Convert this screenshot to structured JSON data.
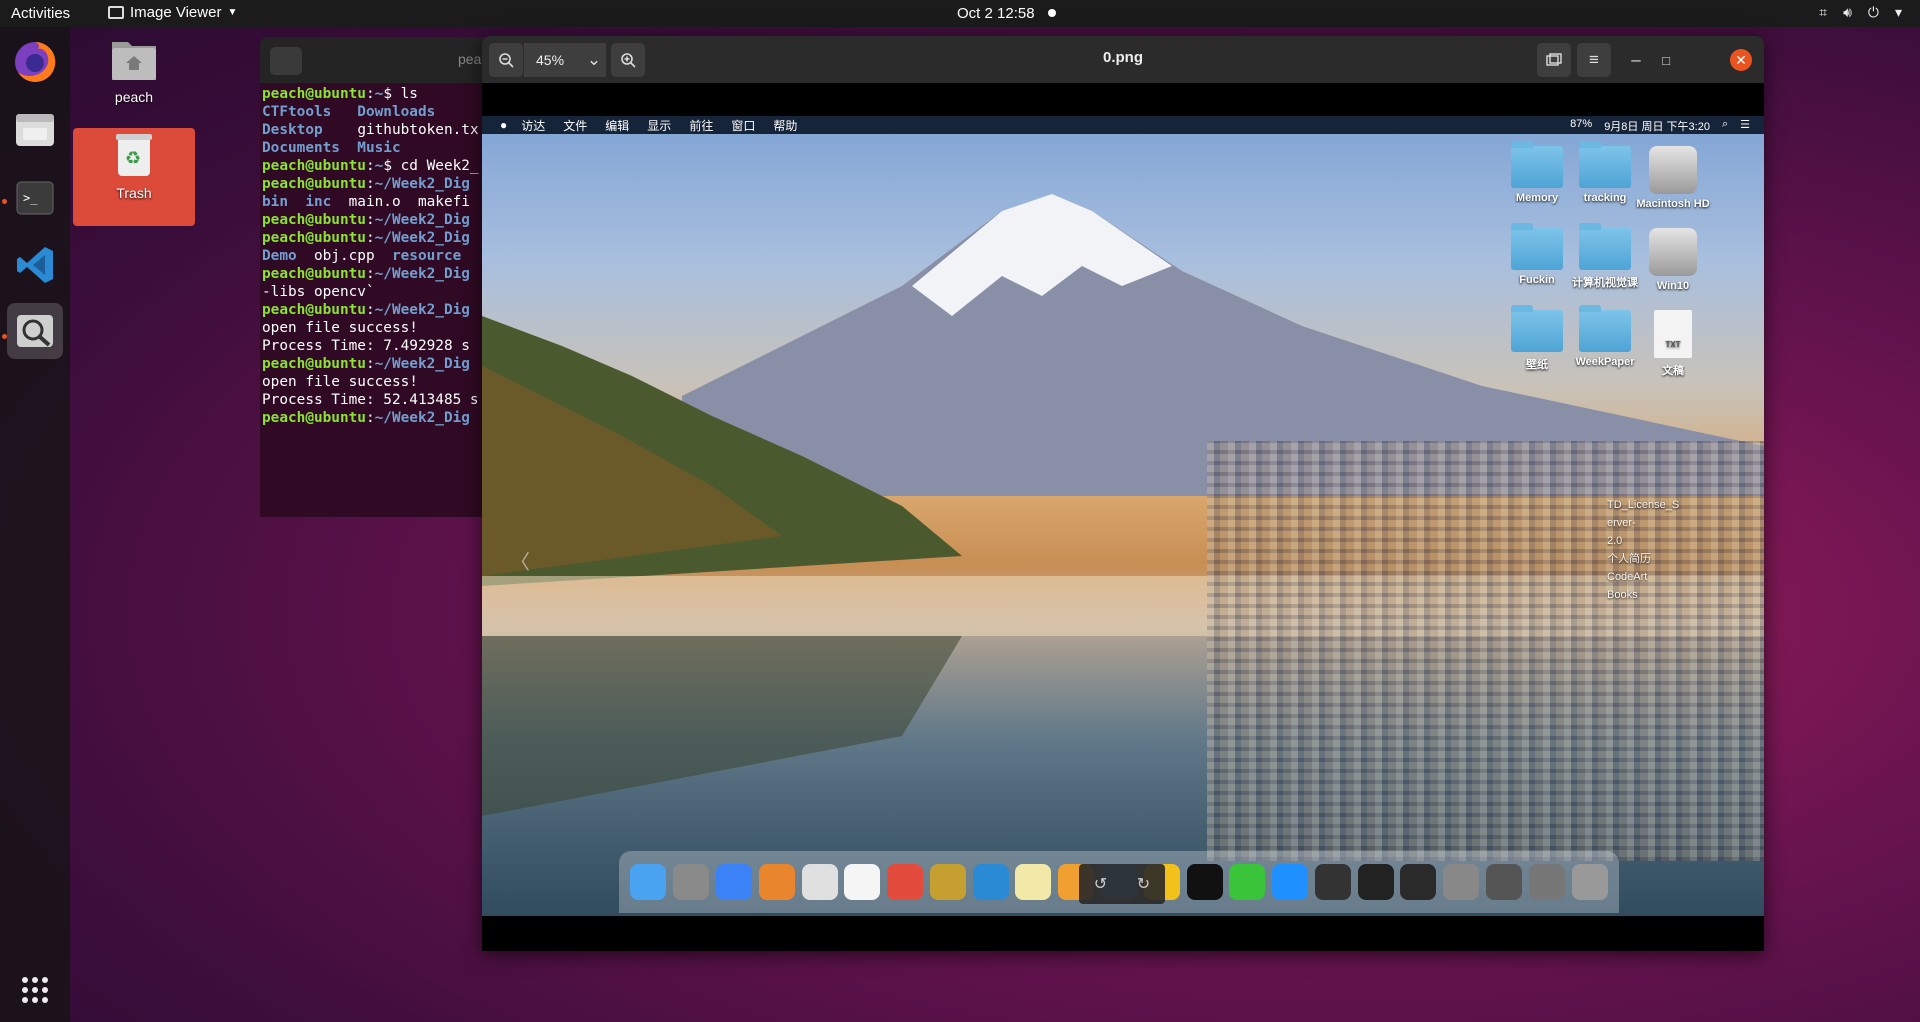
{
  "topbar": {
    "activities": "Activities",
    "app_name": "Image Viewer",
    "clock": "Oct 2  12:58"
  },
  "desktop": {
    "home_label": "peach",
    "trash_label": "Trash"
  },
  "terminal": {
    "title": "pea",
    "lines": [
      [
        {
          "t": "peach@ubuntu",
          "c": "g"
        },
        {
          "t": ":",
          "c": "w"
        },
        {
          "t": "~",
          "c": "b"
        },
        {
          "t": "$ ls",
          "c": "w"
        }
      ],
      [
        {
          "t": "CTFtools   Downloads",
          "c": "b"
        }
      ],
      [
        {
          "t": "Desktop    ",
          "c": "b"
        },
        {
          "t": "githubtoken.tx",
          "c": "w"
        }
      ],
      [
        {
          "t": "Documents  Music",
          "c": "b"
        }
      ],
      [
        {
          "t": "peach@ubuntu",
          "c": "g"
        },
        {
          "t": ":",
          "c": "w"
        },
        {
          "t": "~",
          "c": "b"
        },
        {
          "t": "$ cd Week2_",
          "c": "w"
        }
      ],
      [
        {
          "t": "peach@ubuntu",
          "c": "g"
        },
        {
          "t": ":",
          "c": "w"
        },
        {
          "t": "~/Week2_Dig",
          "c": "b"
        }
      ],
      [
        {
          "t": "bin  inc  ",
          "c": "b"
        },
        {
          "t": "main.o  makefi",
          "c": "w"
        }
      ],
      [
        {
          "t": "peach@ubuntu",
          "c": "g"
        },
        {
          "t": ":",
          "c": "w"
        },
        {
          "t": "~/Week2_Dig",
          "c": "b"
        }
      ],
      [
        {
          "t": "peach@ubuntu",
          "c": "g"
        },
        {
          "t": ":",
          "c": "w"
        },
        {
          "t": "~/Week2_Dig",
          "c": "b"
        }
      ],
      [
        {
          "t": "Demo  ",
          "c": "b"
        },
        {
          "t": "obj.cpp  ",
          "c": "w"
        },
        {
          "t": "resource",
          "c": "b"
        }
      ],
      [
        {
          "t": "peach@ubuntu",
          "c": "g"
        },
        {
          "t": ":",
          "c": "w"
        },
        {
          "t": "~/Week2_Dig",
          "c": "b"
        }
      ],
      [
        {
          "t": "-libs opencv`",
          "c": "w"
        }
      ],
      [
        {
          "t": "peach@ubuntu",
          "c": "g"
        },
        {
          "t": ":",
          "c": "w"
        },
        {
          "t": "~/Week2_Dig",
          "c": "b"
        }
      ],
      [
        {
          "t": "open file success!",
          "c": "w"
        }
      ],
      [
        {
          "t": "Process Time: 7.492928 s",
          "c": "w"
        }
      ],
      [
        {
          "t": "peach@ubuntu",
          "c": "g"
        },
        {
          "t": ":",
          "c": "w"
        },
        {
          "t": "~/Week2_Dig",
          "c": "b"
        }
      ],
      [
        {
          "t": "open file success!",
          "c": "w"
        }
      ],
      [
        {
          "t": "Process Time: 52.413485 s",
          "c": "w"
        }
      ],
      [
        {
          "t": "peach@ubuntu",
          "c": "g"
        },
        {
          "t": ":",
          "c": "w"
        },
        {
          "t": "~/Week2_Dig",
          "c": "b"
        }
      ]
    ]
  },
  "viewer": {
    "zoom": "45%",
    "title": "0.png"
  },
  "mac": {
    "menu": [
      "访达",
      "文件",
      "编辑",
      "显示",
      "前往",
      "窗口",
      "帮助"
    ],
    "battery": "87%",
    "datetime": "9月8日 周日 下午3:20",
    "desktop_items": [
      {
        "label": "Memory",
        "kind": "folder",
        "col": 0,
        "row": 0
      },
      {
        "label": "tracking",
        "kind": "folder",
        "col": 1,
        "row": 0
      },
      {
        "label": "Macintosh HD",
        "kind": "drive",
        "col": 2,
        "row": 0
      },
      {
        "label": "Fuckin",
        "kind": "folder",
        "col": 0,
        "row": 1
      },
      {
        "label": "计算机视觉课",
        "kind": "folder",
        "col": 1,
        "row": 1
      },
      {
        "label": "Win10",
        "kind": "drive",
        "col": 2,
        "row": 1
      },
      {
        "label": "壁纸",
        "kind": "folder",
        "col": 0,
        "row": 2
      },
      {
        "label": "WeekPaper",
        "kind": "folder",
        "col": 1,
        "row": 2
      },
      {
        "label": "文稿",
        "kind": "doc",
        "col": 2,
        "row": 2
      }
    ],
    "doc_badge": "TXT",
    "glitch_text": [
      "TD_License_S",
      "erver-",
      "2.0",
      "个人简历",
      "CodeArt",
      "Books"
    ]
  },
  "colors": {
    "ubuntu_orange": "#e95420",
    "terminal_bg": "#300a24",
    "prompt_green": "#8ae234",
    "dir_blue": "#729fcf"
  }
}
